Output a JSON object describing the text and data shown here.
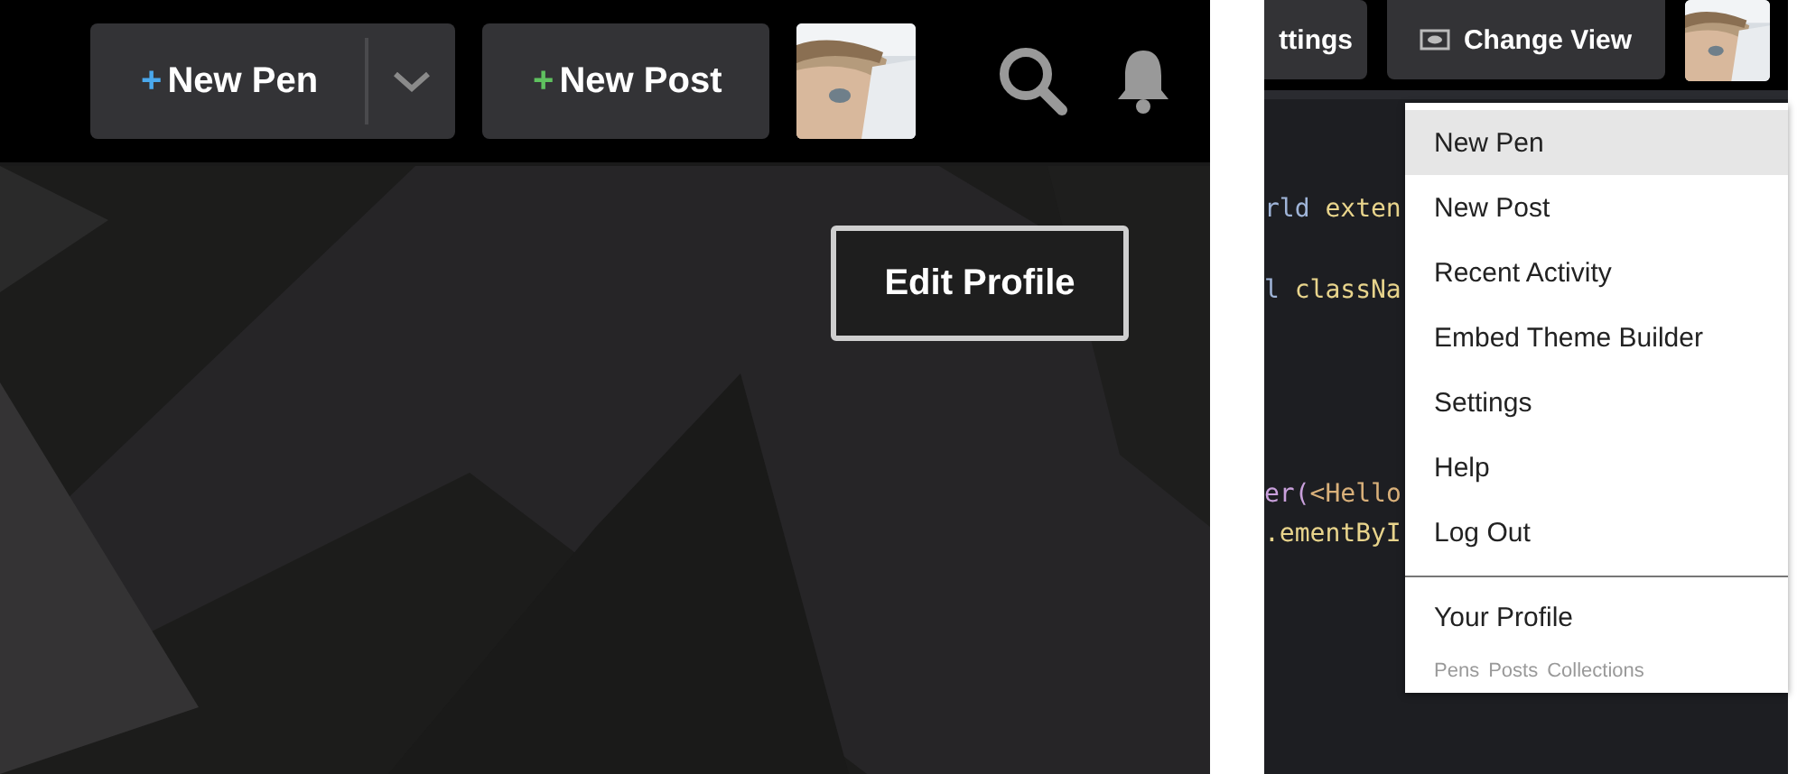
{
  "profile_page": {
    "header": {
      "buttons": [
        {
          "plus": "+",
          "label": "New Pen",
          "color": "#4aa8ec",
          "split": true
        },
        {
          "plus": "+",
          "label": "New Post",
          "color": "#5fc15f",
          "split": false
        }
      ]
    },
    "edit_button": "Edit Profile"
  },
  "editor_page": {
    "header": {
      "buttons": [
        {
          "label": "ttings",
          "icon": false
        },
        {
          "label": "Change View",
          "icon": true
        }
      ]
    },
    "code_lines": [
      {
        "kind": "code",
        "tokens": [
          {
            "text": "rld ",
            "kind": "name"
          },
          {
            "text": "exten",
            "kind": "keyword"
          }
        ]
      },
      {
        "kind": "blank"
      },
      {
        "kind": "code",
        "tokens": [
          {
            "text": "l ",
            "kind": "name"
          },
          {
            "text": "classNa",
            "kind": "keyword"
          }
        ]
      },
      {
        "kind": "blank"
      },
      {
        "kind": "blank"
      },
      {
        "kind": "blank"
      },
      {
        "kind": "blank"
      },
      {
        "kind": "code",
        "tokens": [
          {
            "text": "er(",
            "kind": "fn"
          },
          {
            "text": "<Hello",
            "kind": "tag"
          }
        ]
      },
      {
        "kind": "code",
        "tokens": [
          {
            "text": ".ementByI",
            "kind": "keyword"
          }
        ]
      }
    ],
    "menu": {
      "items": [
        {
          "label": "New Pen",
          "selected": true
        },
        {
          "label": "New Post",
          "selected": false
        },
        {
          "label": "Recent Activity",
          "selected": false
        },
        {
          "label": "Embed Theme Builder",
          "selected": false
        },
        {
          "label": "Settings",
          "selected": false
        },
        {
          "label": "Help",
          "selected": false
        },
        {
          "label": "Log Out",
          "selected": false
        }
      ],
      "profile": {
        "label": "Your Profile",
        "links": [
          "Pens",
          "Posts",
          "Collections"
        ]
      }
    }
  }
}
